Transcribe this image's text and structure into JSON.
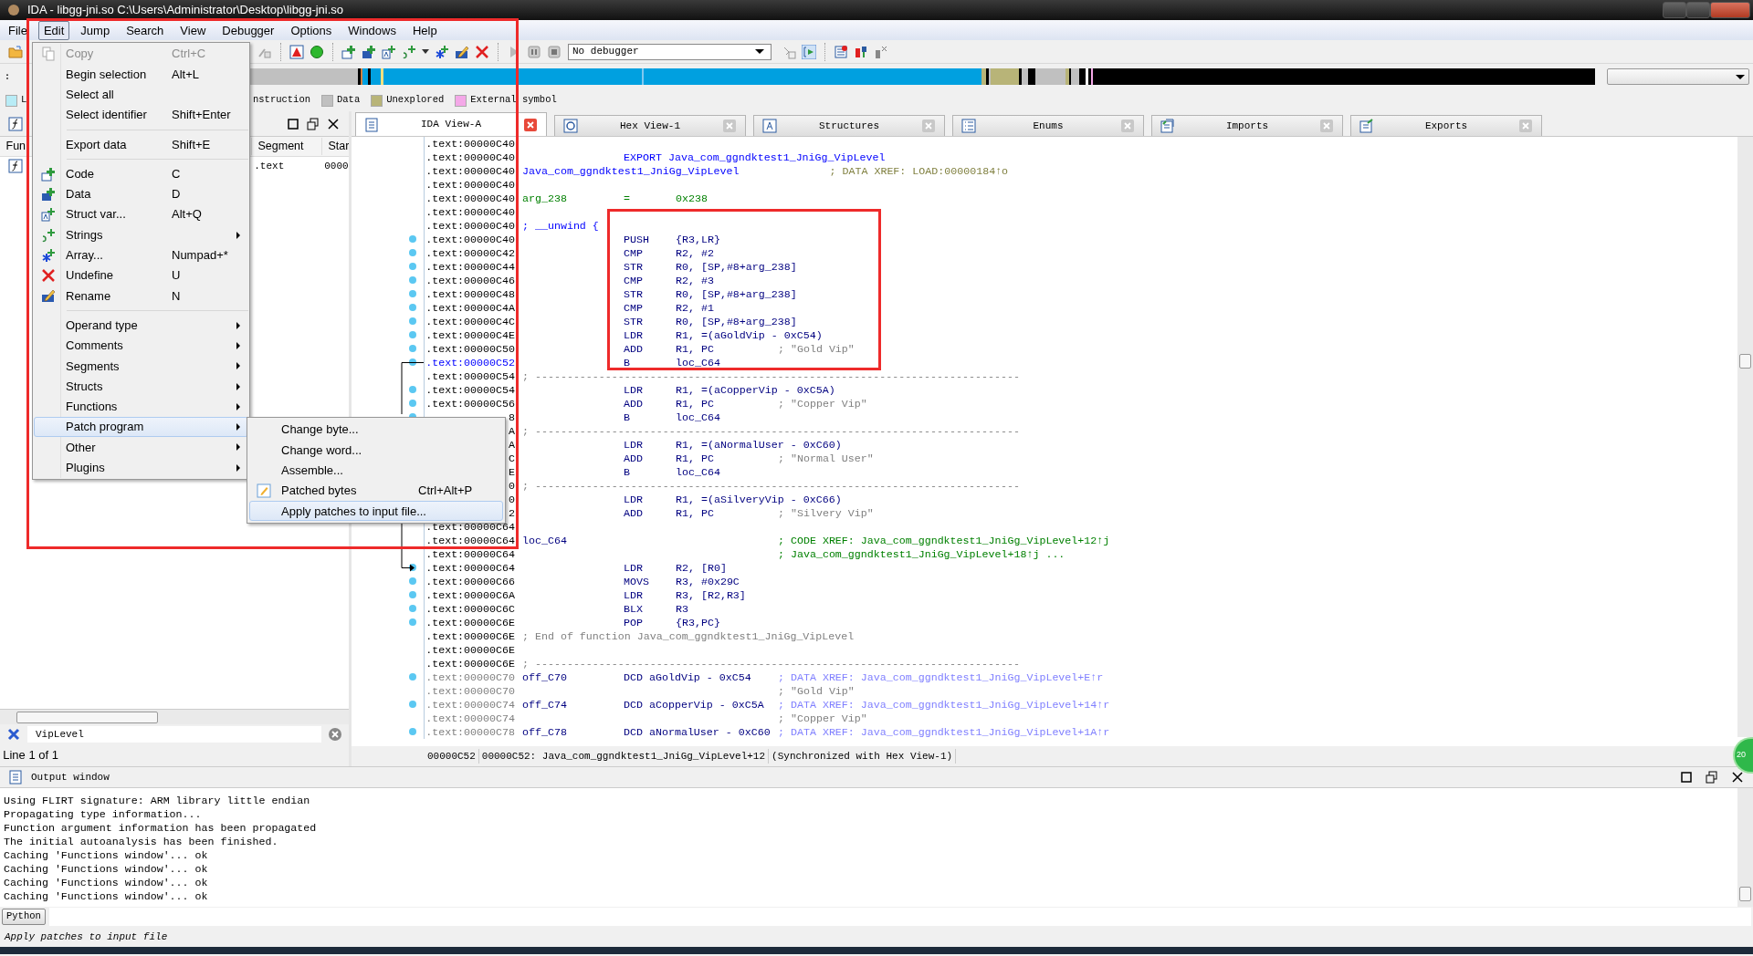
{
  "window": {
    "title": "IDA - libgg-jni.so C:\\Users\\Administrator\\Desktop\\libgg-jni.so"
  },
  "menu_bar": [
    {
      "label": "File",
      "selected": false
    },
    {
      "label": "Edit",
      "selected": true
    },
    {
      "label": "Jump",
      "selected": false
    },
    {
      "label": "Search",
      "selected": false
    },
    {
      "label": "View",
      "selected": false
    },
    {
      "label": "Debugger",
      "selected": false
    },
    {
      "label": "Options",
      "selected": false
    },
    {
      "label": "Windows",
      "selected": false
    },
    {
      "label": "Help",
      "selected": false
    }
  ],
  "toolbar": {
    "debugger_select": "No debugger"
  },
  "legend": [
    {
      "label": "L",
      "color": "#b8ecf6"
    },
    {
      "label": "nstruction"
    },
    {
      "label": "Data",
      "color": "#c0c0c0"
    },
    {
      "label": "Unexplored",
      "color": "#b8b478"
    },
    {
      "label": "External symbol",
      "color": "#f4a8e8"
    }
  ],
  "functions_panel": {
    "columns": [
      "Fun",
      "Segment",
      "Star"
    ],
    "rows": [
      {
        "segment": ".text",
        "start": "0000"
      }
    ],
    "filter": "VipLevel",
    "status": "Line 1 of 1"
  },
  "tabs": [
    {
      "label": "IDA View-A",
      "selected": true
    },
    {
      "label": "Hex View-1",
      "selected": false
    },
    {
      "label": "Structures",
      "selected": false
    },
    {
      "label": "Enums",
      "selected": false
    },
    {
      "label": "Imports",
      "selected": false
    },
    {
      "label": "Exports",
      "selected": false
    }
  ],
  "listing": {
    "rows": [
      {
        "addr": ".text:00000C40",
        "selected": false,
        "dot": false,
        "kind": "code"
      },
      {
        "addr": ".text:00000C40",
        "selected": false,
        "dot": false,
        "kind": "directive",
        "mnemonic": "EXPORT",
        "operands": "Java_com_ggndktest1_JniGg_VipLevel"
      },
      {
        "addr": ".text:00000C40",
        "selected": false,
        "dot": false,
        "kind": "entry",
        "label": "Java_com_ggndktest1_JniGg_VipLevel",
        "comment": "; DATA XREF: LOAD:00000184↑o"
      },
      {
        "addr": ".text:00000C40",
        "selected": false,
        "dot": false,
        "kind": "code"
      },
      {
        "addr": ".text:00000C40",
        "selected": false,
        "dot": false,
        "kind": "stackvar",
        "label": "arg_238",
        "mnemonic": "=",
        "operands": "0x238"
      },
      {
        "addr": ".text:00000C40",
        "selected": false,
        "dot": false,
        "kind": "code"
      },
      {
        "addr": ".text:00000C40",
        "selected": false,
        "dot": false,
        "kind": "unwind",
        "text": "; __unwind {"
      },
      {
        "addr": ".text:00000C40",
        "selected": false,
        "dot": true,
        "kind": "code",
        "mnemonic": "PUSH",
        "operands": "{R3,LR}"
      },
      {
        "addr": ".text:00000C42",
        "selected": false,
        "dot": true,
        "kind": "code",
        "mnemonic": "CMP",
        "operands": "R2, #2"
      },
      {
        "addr": ".text:00000C44",
        "selected": false,
        "dot": true,
        "kind": "code",
        "mnemonic": "STR",
        "operands": "R0, [SP,#8+arg_238]"
      },
      {
        "addr": ".text:00000C46",
        "selected": false,
        "dot": true,
        "kind": "code",
        "mnemonic": "CMP",
        "operands": "R2, #3"
      },
      {
        "addr": ".text:00000C48",
        "selected": false,
        "dot": true,
        "kind": "code",
        "mnemonic": "STR",
        "operands": "R0, [SP,#8+arg_238]"
      },
      {
        "addr": ".text:00000C4A",
        "selected": false,
        "dot": true,
        "kind": "code",
        "mnemonic": "CMP",
        "operands": "R2, #1"
      },
      {
        "addr": ".text:00000C4C",
        "selected": false,
        "dot": true,
        "kind": "code",
        "mnemonic": "STR",
        "operands": "R0, [SP,#8+arg_238]"
      },
      {
        "addr": ".text:00000C4E",
        "selected": false,
        "dot": true,
        "kind": "code",
        "mnemonic": "LDR",
        "operands": "R1, =(aGoldVip - 0xC54)"
      },
      {
        "addr": ".text:00000C50",
        "selected": false,
        "dot": true,
        "kind": "code",
        "mnemonic": "ADD",
        "operands": "R1, PC",
        "comment": "; \"Gold Vip\""
      },
      {
        "addr": ".text:00000C52",
        "selected": true,
        "dot": true,
        "kind": "code",
        "mnemonic": "B",
        "operands": "loc_C64"
      },
      {
        "addr": ".text:00000C54",
        "selected": false,
        "dot": false,
        "kind": "note",
        "text": "; ----------------------------------------------------------------------------"
      },
      {
        "addr": ".text:00000C54",
        "selected": false,
        "dot": true,
        "kind": "code",
        "mnemonic": "LDR",
        "operands": "R1, =(aCopperVip - 0xC5A)"
      },
      {
        "addr": ".text:00000C56",
        "selected": false,
        "dot": true,
        "kind": "code",
        "mnemonic": "ADD",
        "operands": "R1, PC",
        "comment": "; \"Copper Vip\""
      },
      {
        "addr": "8",
        "selected": false,
        "dot": true,
        "kind": "code",
        "mnemonic": "B",
        "operands": "loc_C64"
      },
      {
        "addr": "A",
        "selected": false,
        "dot": false,
        "kind": "note",
        "text": "; ----------------------------------------------------------------------------"
      },
      {
        "addr": "A",
        "selected": false,
        "dot": false,
        "kind": "code",
        "mnemonic": "LDR",
        "operands": "R1, =(aNormalUser - 0xC60)"
      },
      {
        "addr": "C",
        "selected": false,
        "dot": false,
        "kind": "code",
        "mnemonic": "ADD",
        "operands": "R1, PC",
        "comment": "; \"Normal User\""
      },
      {
        "addr": "E",
        "selected": false,
        "dot": false,
        "kind": "code",
        "mnemonic": "B",
        "operands": "loc_C64"
      },
      {
        "addr": "0",
        "selected": false,
        "dot": false,
        "kind": "note",
        "text": "; ----------------------------------------------------------------------------"
      },
      {
        "addr": "0",
        "selected": false,
        "dot": false,
        "kind": "code",
        "mnemonic": "LDR",
        "operands": "R1, =(aSilveryVip - 0xC66)"
      },
      {
        "addr": "2",
        "selected": false,
        "dot": false,
        "kind": "code",
        "mnemonic": "ADD",
        "operands": "R1, PC",
        "comment": "; \"Silvery Vip\""
      },
      {
        "addr": ".text:00000C64",
        "selected": false,
        "dot": false,
        "kind": "code"
      },
      {
        "addr": ".text:00000C64",
        "selected": false,
        "dot": false,
        "kind": "xref",
        "label": "loc_C64",
        "comment": "; CODE XREF: Java_com_ggndktest1_JniGg_VipLevel+12↑j"
      },
      {
        "addr": ".text:00000C64",
        "selected": false,
        "dot": false,
        "kind": "xref",
        "comment": "; Java_com_ggndktest1_JniGg_VipLevel+18↑j ..."
      },
      {
        "addr": ".text:00000C64",
        "selected": false,
        "dot": true,
        "kind": "code",
        "mnemonic": "LDR",
        "operands": "R2, [R0]"
      },
      {
        "addr": ".text:00000C66",
        "selected": false,
        "dot": true,
        "kind": "code",
        "mnemonic": "MOVS",
        "operands": "R3, #0x29C"
      },
      {
        "addr": ".text:00000C6A",
        "selected": false,
        "dot": true,
        "kind": "code",
        "mnemonic": "LDR",
        "operands": "R3, [R2,R3]"
      },
      {
        "addr": ".text:00000C6C",
        "selected": false,
        "dot": true,
        "kind": "code",
        "mnemonic": "BLX",
        "operands": "R3"
      },
      {
        "addr": ".text:00000C6E",
        "selected": false,
        "dot": true,
        "kind": "code",
        "mnemonic": "POP",
        "operands": "{R3,PC}"
      },
      {
        "addr": ".text:00000C6E",
        "selected": false,
        "dot": false,
        "kind": "note",
        "text": "; End of function Java_com_ggndktest1_JniGg_VipLevel"
      },
      {
        "addr": ".text:00000C6E",
        "selected": false,
        "dot": false,
        "kind": "code"
      },
      {
        "addr": ".text:00000C6E",
        "selected": false,
        "dot": false,
        "kind": "note",
        "text": "; ----------------------------------------------------------------------------"
      },
      {
        "addr": ".text:00000C70",
        "selected": false,
        "dot": true,
        "kind": "data_ref",
        "label": "off_C70",
        "mnemonic": "DCD",
        "operands": "aGoldVip - 0xC54",
        "comment": "; DATA XREF: Java_com_ggndktest1_JniGg_VipLevel+E↑r"
      },
      {
        "addr": ".text:00000C70",
        "selected": false,
        "dot": false,
        "kind": "data_note",
        "comment": "; \"Gold Vip\""
      },
      {
        "addr": ".text:00000C74",
        "selected": false,
        "dot": true,
        "kind": "data_ref",
        "label": "off_C74",
        "mnemonic": "DCD",
        "operands": "aCopperVip - 0xC5A",
        "comment": "; DATA XREF: Java_com_ggndktest1_JniGg_VipLevel+14↑r"
      },
      {
        "addr": ".text:00000C74",
        "selected": false,
        "dot": false,
        "kind": "data_note",
        "comment": "; \"Copper Vip\""
      },
      {
        "addr": ".text:00000C78",
        "selected": false,
        "dot": true,
        "kind": "data_ref",
        "label": "off_C78",
        "mnemonic": "DCD",
        "operands": "aNormalUser - 0xC60",
        "comment": "; DATA XREF: Java_com_ggndktest1_JniGg_VipLevel+1A↑r"
      }
    ]
  },
  "view_status": [
    "00000C52",
    "00000C52: Java_com_ggndktest1_JniGg_VipLevel+12",
    "(Synchronized with Hex View-1)"
  ],
  "side_widget": "20",
  "output": {
    "title": "Output window",
    "lines": [
      "Using FLIRT signature: ARM library little endian",
      "Propagating type information...",
      "Function argument information has been propagated",
      "The initial autoanalysis has been finished.",
      "Caching 'Functions window'... ok",
      "Caching 'Functions window'... ok",
      "Caching 'Functions window'... ok",
      "Caching 'Functions window'... ok"
    ]
  },
  "python_button": "Python",
  "status_line": "Apply patches to input file",
  "edit_menu": [
    {
      "kind": "item",
      "label": "Copy",
      "shortcut": "Ctrl+C",
      "disabled": true,
      "submenu": false,
      "selected": false
    },
    {
      "kind": "item",
      "label": "Begin selection",
      "shortcut": "Alt+L",
      "disabled": false,
      "submenu": false,
      "selected": false
    },
    {
      "kind": "item",
      "label": "Select all",
      "disabled": false,
      "submenu": false,
      "selected": false
    },
    {
      "kind": "item",
      "label": "Select identifier",
      "shortcut": "Shift+Enter",
      "disabled": false,
      "submenu": false,
      "selected": false
    },
    {
      "kind": "separator"
    },
    {
      "kind": "item",
      "label": "Export data",
      "shortcut": "Shift+E",
      "disabled": false,
      "submenu": false,
      "selected": false
    },
    {
      "kind": "separator"
    },
    {
      "kind": "item",
      "label": "Code",
      "shortcut": "C",
      "disabled": false,
      "submenu": false,
      "selected": false
    },
    {
      "kind": "item",
      "label": "Data",
      "shortcut": "D",
      "disabled": false,
      "submenu": false,
      "selected": false
    },
    {
      "kind": "item",
      "label": "Struct var...",
      "shortcut": "Alt+Q",
      "disabled": false,
      "submenu": false,
      "selected": false
    },
    {
      "kind": "item",
      "label": "Strings",
      "disabled": false,
      "submenu": true,
      "selected": false
    },
    {
      "kind": "item",
      "label": "Array...",
      "shortcut": "Numpad+*",
      "disabled": false,
      "submenu": false,
      "selected": false
    },
    {
      "kind": "item",
      "label": "Undefine",
      "shortcut": "U",
      "disabled": false,
      "submenu": false,
      "selected": false
    },
    {
      "kind": "item",
      "label": "Rename",
      "shortcut": "N",
      "disabled": false,
      "submenu": false,
      "selected": false
    },
    {
      "kind": "separator"
    },
    {
      "kind": "item",
      "label": "Operand type",
      "disabled": false,
      "submenu": true,
      "selected": false
    },
    {
      "kind": "item",
      "label": "Comments",
      "disabled": false,
      "submenu": true,
      "selected": false
    },
    {
      "kind": "item",
      "label": "Segments",
      "disabled": false,
      "submenu": true,
      "selected": false
    },
    {
      "kind": "item",
      "label": "Structs",
      "disabled": false,
      "submenu": true,
      "selected": false
    },
    {
      "kind": "item",
      "label": "Functions",
      "disabled": false,
      "submenu": true,
      "selected": false
    },
    {
      "kind": "item",
      "label": "Patch program",
      "disabled": false,
      "submenu": true,
      "selected": true
    },
    {
      "kind": "item",
      "label": "Other",
      "disabled": false,
      "submenu": true,
      "selected": false
    },
    {
      "kind": "item",
      "label": "Plugins",
      "disabled": false,
      "submenu": true,
      "selected": false
    }
  ],
  "patch_submenu": [
    {
      "label": "Change byte...",
      "selected": false
    },
    {
      "label": "Change word...",
      "selected": false
    },
    {
      "label": "Assemble...",
      "selected": false
    },
    {
      "label": "Patched bytes",
      "shortcut": "Ctrl+Alt+P",
      "selected": false
    },
    {
      "label": "Apply patches to input file...",
      "selected": true
    }
  ]
}
